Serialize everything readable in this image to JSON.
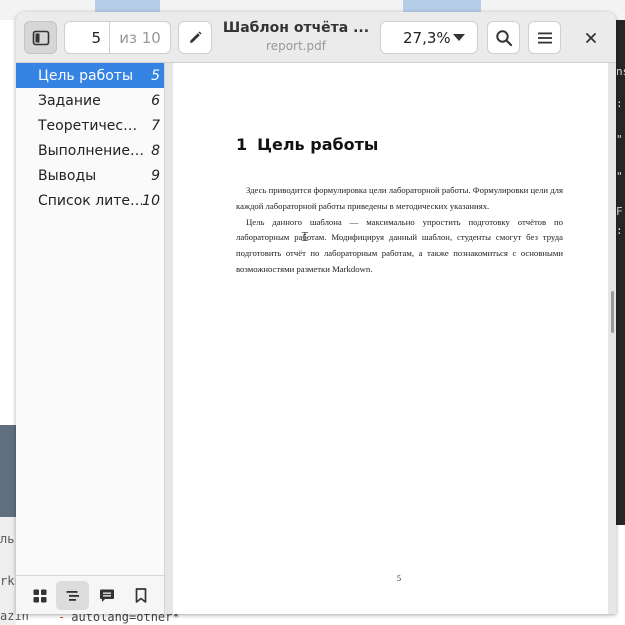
{
  "background": {
    "right_terminal_chars": [
      "ns",
      ":",
      "\"",
      "\"",
      "F",
      ":"
    ],
    "left_fragments": [
      "ль",
      "rks",
      "azin"
    ],
    "bottom_code": "autolang=other*"
  },
  "header": {
    "sidebar_toggle_icon": "sidebar-icon",
    "current_page": "5",
    "total_pages": "из 10",
    "edit_icon": "pencil-icon",
    "title": "Шаблон отчёта ...",
    "subtitle": "report.pdf",
    "zoom": "27,3%",
    "search_icon": "search-icon",
    "menu_icon": "hamburger-icon",
    "close_icon": "close-icon"
  },
  "sidebar": {
    "items": [
      {
        "label": "Цель работы",
        "page": "5"
      },
      {
        "label": "Задание",
        "page": "6"
      },
      {
        "label": "Теоретичес…",
        "page": "7"
      },
      {
        "label": "Выполнение…",
        "page": "8"
      },
      {
        "label": "Выводы",
        "page": "9"
      },
      {
        "label": "Список лите…",
        "page": "10"
      }
    ],
    "selected_index": 0,
    "bottom_buttons": [
      "thumbnails-icon",
      "outline-icon",
      "annotations-icon",
      "bookmarks-icon"
    ]
  },
  "document": {
    "section_number": "1",
    "section_title": "Цель работы",
    "paragraphs": [
      "Здесь приводится формулировка цели лабораторной работы. Формулировки цели для каждой лабораторной работы приведены в методических указаниях.",
      "Цель данного шаблона — максимально упростить подготовку отчётов по лабораторным работам. Модифицируя данный шаблон, студенты смогут без труда подготовить отчёт по лабораторным работам, а также познакомиться с основными возможностями разметки Markdown."
    ],
    "page_number": "5"
  },
  "colors": {
    "accent": "#3584e4",
    "header_bg": "#ebebeb",
    "page_bg": "#ffffff"
  }
}
